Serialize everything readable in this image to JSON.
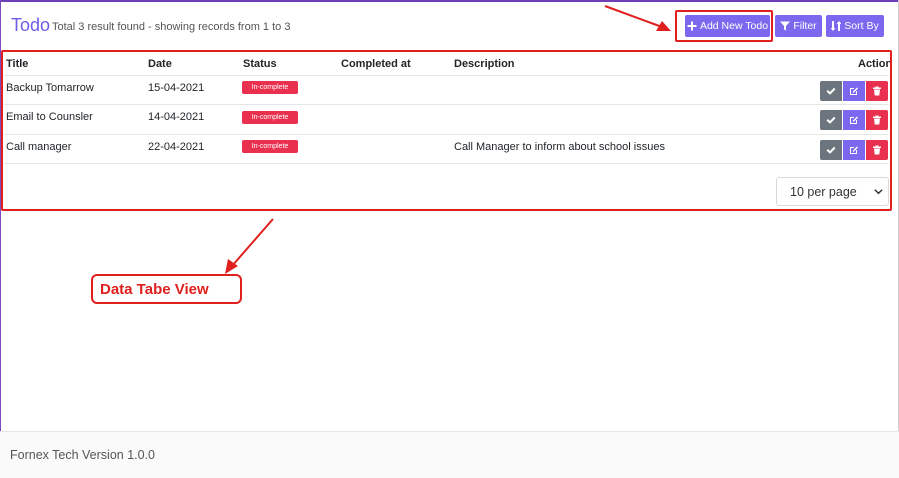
{
  "header": {
    "title": "Todo",
    "subtitle": "Total 3 result found - showing records from 1 to 3"
  },
  "toolbar": {
    "add_label": "Add New Todo",
    "filter_label": "Filter",
    "sort_label": "Sort By"
  },
  "table": {
    "columns": [
      "Title",
      "Date",
      "Status",
      "Completed at",
      "Description",
      "Action"
    ],
    "rows": [
      {
        "title": "Backup Tomarrow",
        "date": "15-04-2021",
        "status": "In-complete",
        "completed_at": "",
        "description": ""
      },
      {
        "title": "Email to Counsler",
        "date": "14-04-2021",
        "status": "In-complete",
        "completed_at": "",
        "description": ""
      },
      {
        "title": "Call manager",
        "date": "22-04-2021",
        "status": "In-complete",
        "completed_at": "",
        "description": "Call Manager to inform about school issues"
      }
    ]
  },
  "pagination": {
    "per_page": "10 per page"
  },
  "annotation": {
    "label": "Data Tabe View"
  },
  "footer": {
    "text": "Fornex Tech Version 1.0.0"
  },
  "colors": {
    "accent": "#7b68ee",
    "danger": "#e9314f",
    "annotation": "#e0201e"
  }
}
